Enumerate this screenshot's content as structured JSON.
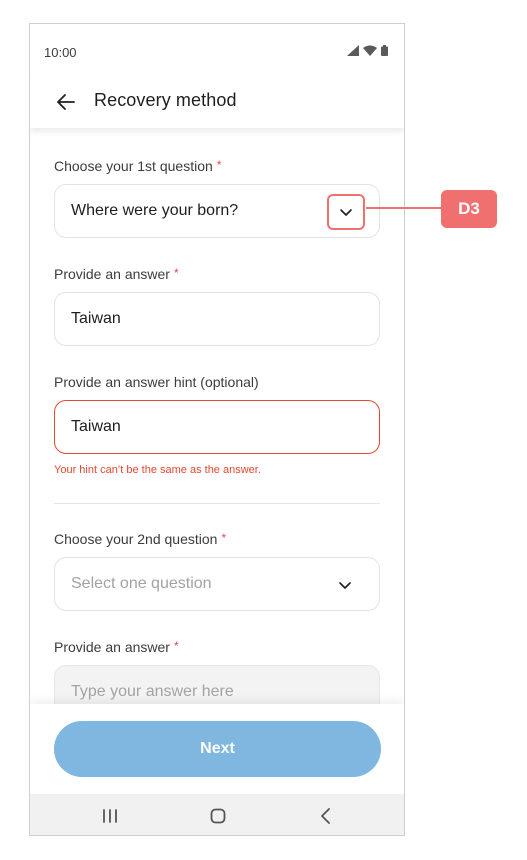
{
  "status_bar": {
    "time": "10:00",
    "icons": [
      "signal-icon",
      "wifi-icon",
      "battery-icon"
    ]
  },
  "header": {
    "title": "Recovery method",
    "back_icon": "arrow-left-icon"
  },
  "form": {
    "q1": {
      "label": "Choose your 1st question",
      "required_mark": "*",
      "value": "Where were your born?"
    },
    "answer1": {
      "label": "Provide an answer",
      "required_mark": "*",
      "value": "Taiwan"
    },
    "hint1": {
      "label": "Provide an answer hint (optional)",
      "value": "Taiwan",
      "error": "Your hint can’t be the same as the answer."
    },
    "q2": {
      "label": "Choose your 2nd question",
      "required_mark": "*",
      "placeholder": "Select one question"
    },
    "answer2": {
      "label": "Provide an answer",
      "required_mark": "*",
      "placeholder": "Type your answer here"
    }
  },
  "footer": {
    "next_label": "Next"
  },
  "annotation": {
    "badge": "D3"
  },
  "colors": {
    "accent_disabled": "#7fb7e0",
    "error": "#e5482e",
    "annotation": "#f07070",
    "required": "#e5484d"
  }
}
